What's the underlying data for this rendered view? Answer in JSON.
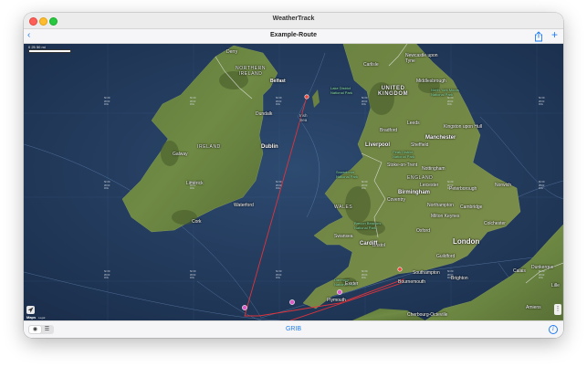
{
  "window": {
    "app_title": "WeatherTrack"
  },
  "navbar": {
    "title": "Example-Route",
    "back_icon": "chevron-left-icon",
    "share_icon": "share-icon",
    "add_label": "+"
  },
  "map": {
    "scale_label": "0      25        50 mi",
    "legal_label": "Legal",
    "maps_label": "Maps",
    "countries": [
      {
        "key": "northern_ireland",
        "text": "NORTHERN\nIRELAND"
      },
      {
        "key": "ireland",
        "text": "IRELAND"
      },
      {
        "key": "united_kingdom",
        "text": "UNITED\nKINGDOM"
      },
      {
        "key": "england",
        "text": "ENGLAND"
      },
      {
        "key": "wales",
        "text": "WALES"
      }
    ],
    "seas": [
      {
        "text": "Irish\nSea"
      }
    ],
    "parks": [
      {
        "text": "Lake District\nNational Park"
      },
      {
        "text": "North York Moors\nNational Park"
      },
      {
        "text": "Peak District\nNational Park"
      },
      {
        "text": "Snowdonia\nNational Park"
      },
      {
        "text": "Brecon Beacons\nNational Park"
      },
      {
        "text": "Dartmoor\nNational Park"
      }
    ],
    "cities_small": [
      "Derry",
      "Carlisle",
      "Newcastle upon Tyne",
      "Middlesbrough",
      "Belfast",
      "Dundalk",
      "Leeds",
      "Bradford",
      "Kingston upon Hull",
      "Galway",
      "Limerick",
      "Waterford",
      "Cork",
      "Sheffield",
      "Stoke-on-Trent",
      "Nottingham",
      "Leicester",
      "Peterborough",
      "Norwich",
      "Coventry",
      "Northampton",
      "Cambridge",
      "Milton Keynes",
      "Colchester",
      "Oxford",
      "Swansea",
      "Bristol",
      "Guildford",
      "Southampton",
      "Brighton",
      "Exeter",
      "Plymouth",
      "Bournemouth",
      "Calais",
      "Lille",
      "Dunkerque",
      "Amiens",
      "Cherbourg-Octeville"
    ],
    "cities_big": [
      "Dublin",
      "Liverpool",
      "Manchester",
      "Birmingham",
      "London",
      "Cardiff"
    ],
    "grid_cell_text": "N=/0\nW=0\n0=k"
  },
  "bottombar": {
    "grib_label": "GRIB",
    "seg_icon_1": "globe-icon",
    "seg_icon_2": "list-icon",
    "info_icon": "info-icon"
  },
  "colors": {
    "accent": "#1f7cf2",
    "route": "#e0343c",
    "waypoint": "#d85cc4"
  }
}
